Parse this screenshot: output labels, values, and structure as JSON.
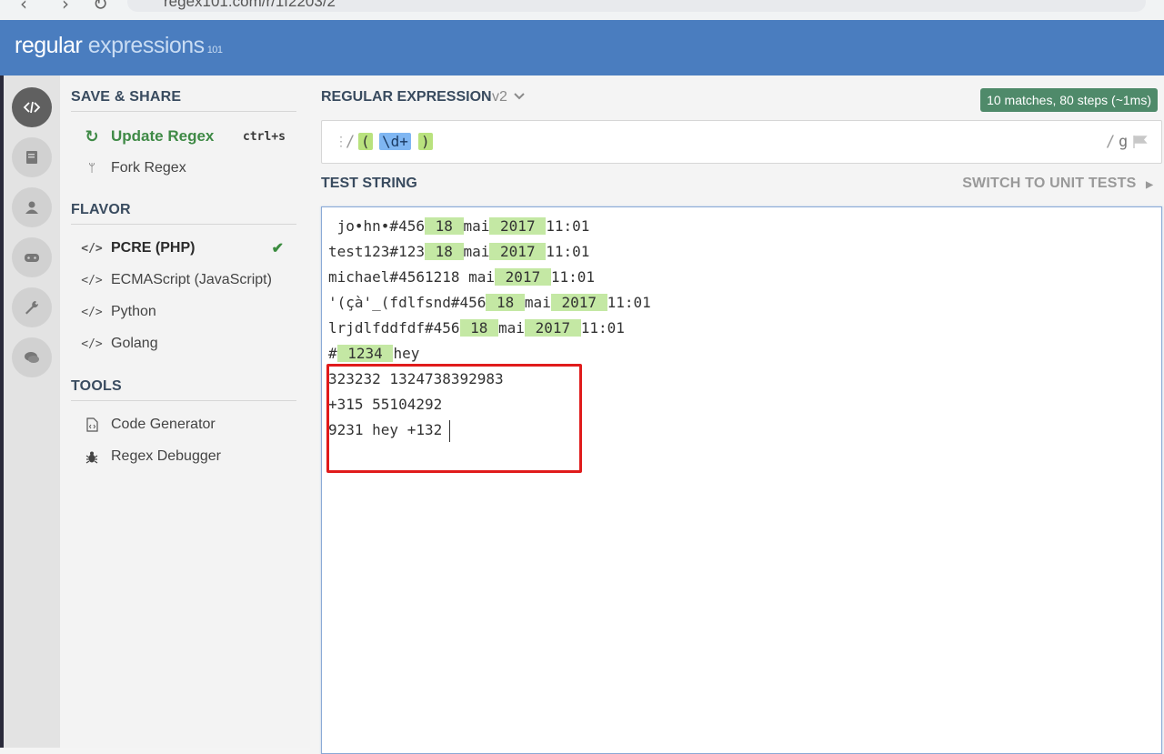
{
  "browser": {
    "url": "regex101.com/r/1f2203/2"
  },
  "header": {
    "logo_main": "regular",
    "logo_sub": "expressions",
    "logo_num": "101"
  },
  "rail": {
    "items": [
      {
        "name": "code-icon",
        "active": true
      },
      {
        "name": "library-icon",
        "active": false
      },
      {
        "name": "user-icon",
        "active": false
      },
      {
        "name": "quiz-icon",
        "active": false
      },
      {
        "name": "tools-icon",
        "active": false
      },
      {
        "name": "chat-icon",
        "active": false
      }
    ]
  },
  "sidebar": {
    "save_share_title": "SAVE & SHARE",
    "update_label": "Update Regex",
    "update_shortcut": "ctrl+s",
    "fork_label": "Fork Regex",
    "flavor_title": "FLAVOR",
    "flavors": [
      "PCRE (PHP)",
      "ECMAScript (JavaScript)",
      "Python",
      "Golang"
    ],
    "tools_title": "TOOLS",
    "tools": [
      "Code Generator",
      "Regex Debugger"
    ]
  },
  "regex": {
    "title": "REGULAR EXPRESSION",
    "version": "v2",
    "match_info": "10 matches, 80 steps (~1ms)",
    "open_delim": "/",
    "group_open": "(",
    "escape": "\\d+",
    "group_close": ")",
    "close_delim": "/",
    "flags": "g"
  },
  "test": {
    "title": "TEST STRING",
    "switch_label": "SWITCH TO UNIT TESTS",
    "lines": [
      [
        " jo•hn•#456",
        "§ 18 ",
        "mai",
        "§ 2017 ",
        "11:01"
      ],
      [
        "test123#123",
        "§ 18 ",
        "mai",
        "§ 2017 ",
        "11:01"
      ],
      [
        "michael#4561218 mai",
        "§ 2017 ",
        "11:01"
      ],
      [
        "'(çà'_(fdlfsnd#456",
        "§ 18 ",
        "mai",
        "§ 2017 ",
        "11:01"
      ],
      [
        "lrjdlfddfdf#456",
        "§ 18 ",
        "mai",
        "§ 2017 ",
        "11:01"
      ],
      [
        "#",
        "§ 1234 ",
        "hey"
      ],
      [
        "323232 1324738392983"
      ],
      [
        "+315 55104292"
      ],
      [
        "9231 hey +132"
      ]
    ]
  }
}
